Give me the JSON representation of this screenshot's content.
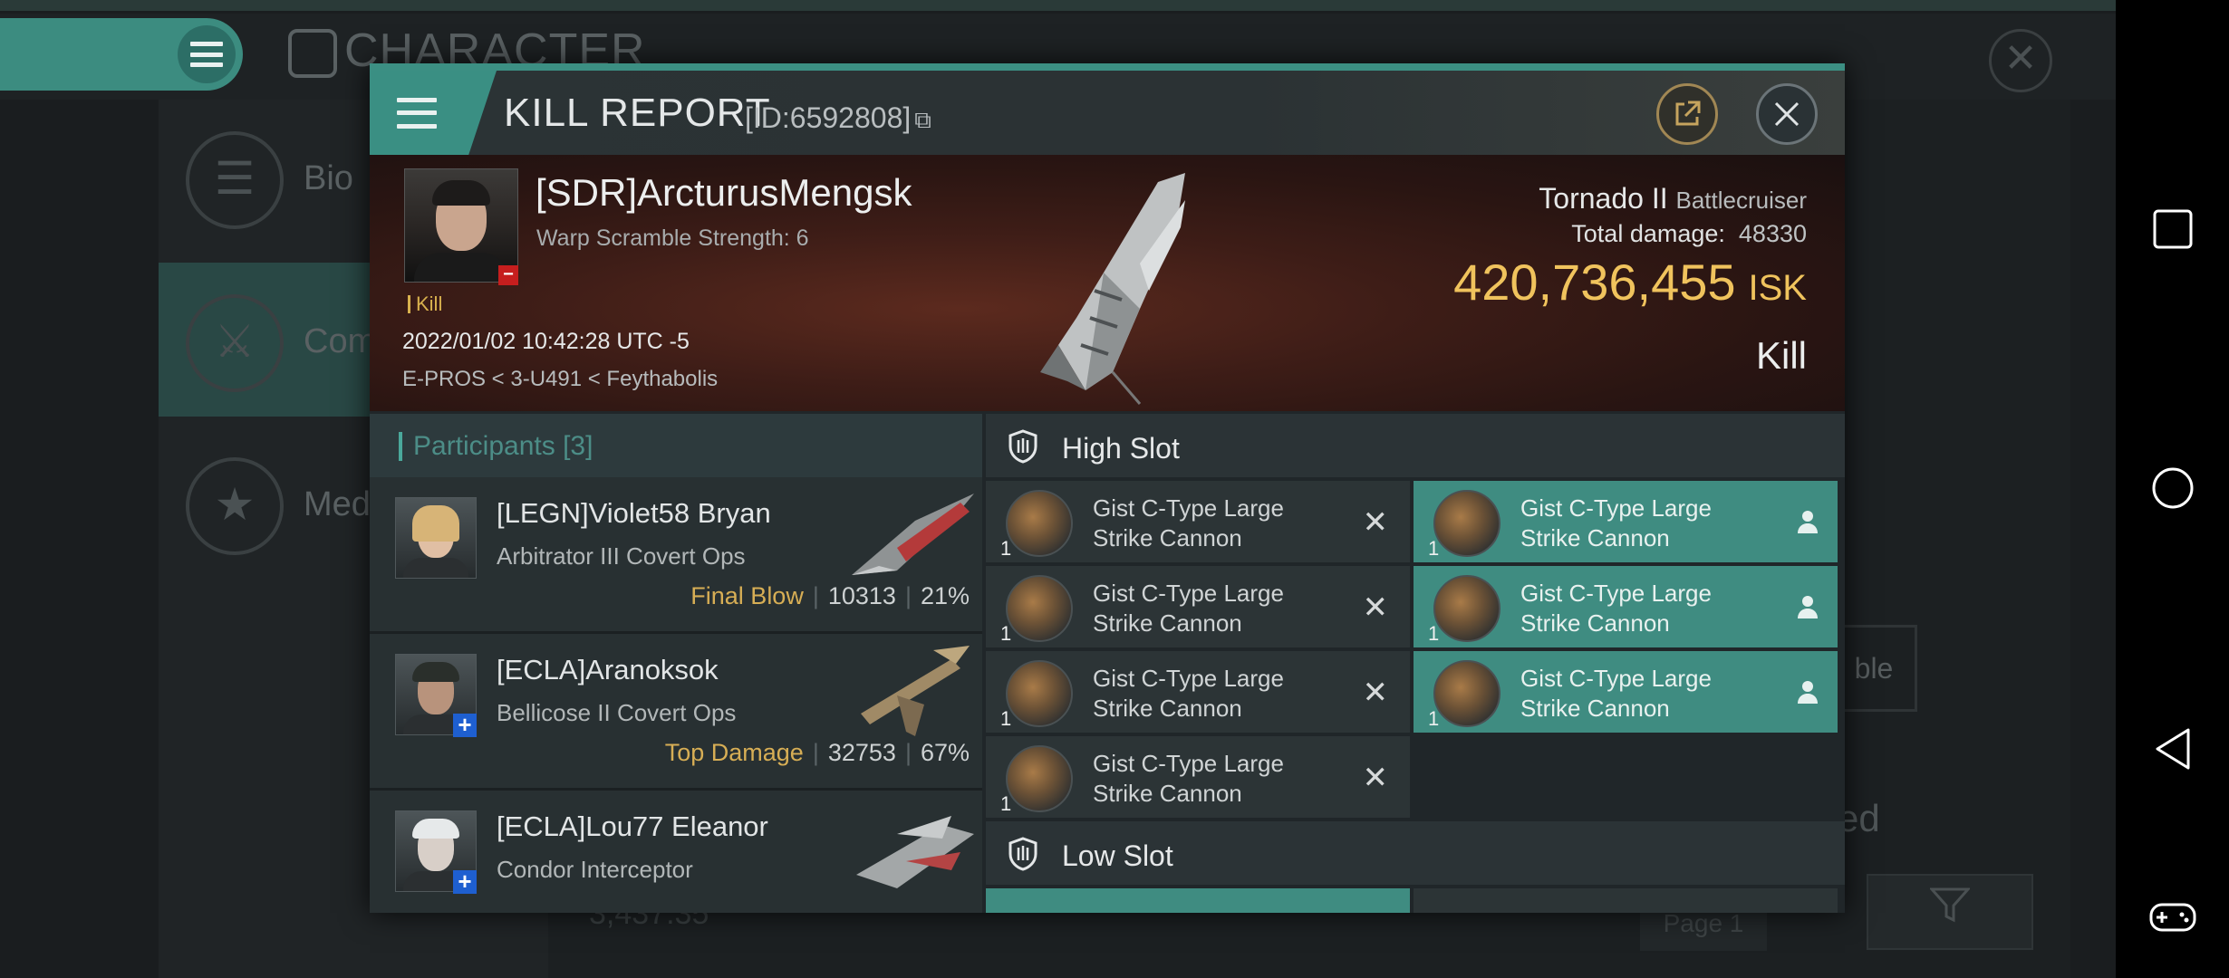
{
  "background": {
    "title": "CHARACTER",
    "sidebar": [
      {
        "label": "Bio",
        "icon": "list-icon"
      },
      {
        "label": "Com",
        "icon": "crossed-swords-icon"
      },
      {
        "label": "Med",
        "icon": "star-medal-icon"
      }
    ],
    "right_fragment_1": "ble",
    "right_fragment_2": "ed",
    "balance": "3,437.35",
    "page_label": "Page 1"
  },
  "modal": {
    "title": "KILL REPORT",
    "id_label": "[ID:6592808]",
    "victim": {
      "name": "[SDR]ArcturusMengsk",
      "subtitle": "Warp Scramble Strength: 6",
      "tag": "Kill",
      "timestamp": "2022/01/02 10:42:28 UTC -5",
      "location": "E-PROS < 3-U491 < Feythabolis",
      "ship_name": "Tornado II",
      "ship_class": "Battlecruiser",
      "damage_label": "Total damage:",
      "damage_value": "48330",
      "isk_value": "420,736,455",
      "isk_unit": "ISK",
      "result": "Kill"
    },
    "participants": {
      "header": "Participants",
      "count": "[3]",
      "rows": [
        {
          "name": "[LEGN]Violet58 Bryan",
          "ship": "Arbitrator III Covert Ops",
          "tag": "Final Blow",
          "damage": "10313",
          "percent": "21%"
        },
        {
          "name": "[ECLA]Aranoksok",
          "ship": "Bellicose II Covert Ops",
          "tag": "Top Damage",
          "damage": "32753",
          "percent": "67%"
        },
        {
          "name": "[ECLA]Lou77 Eleanor",
          "ship": "Condor Interceptor",
          "tag": "",
          "damage": "",
          "percent": ""
        }
      ]
    },
    "high_slot": {
      "header": "High Slot",
      "left": [
        {
          "name_l1": "Gist C-Type Large",
          "name_l2": "Strike Cannon",
          "qty": "1"
        },
        {
          "name_l1": "Gist C-Type Large",
          "name_l2": "Strike Cannon",
          "qty": "1"
        },
        {
          "name_l1": "Gist C-Type Large",
          "name_l2": "Strike Cannon",
          "qty": "1"
        },
        {
          "name_l1": "Gist C-Type Large",
          "name_l2": "Strike Cannon",
          "qty": "1"
        }
      ],
      "right": [
        {
          "name_l1": "Gist C-Type Large",
          "name_l2": "Strike Cannon",
          "qty": "1"
        },
        {
          "name_l1": "Gist C-Type Large",
          "name_l2": "Strike Cannon",
          "qty": "1"
        },
        {
          "name_l1": "Gist C-Type Large",
          "name_l2": "Strike Cannon",
          "qty": "1"
        }
      ]
    },
    "low_slot": {
      "header": "Low Slot"
    }
  },
  "colors": {
    "accent": "#3c8f83",
    "isk_gold": "#f0c35d",
    "tag_gold": "#d7ae55",
    "banner_red": "#5c2a1e"
  }
}
